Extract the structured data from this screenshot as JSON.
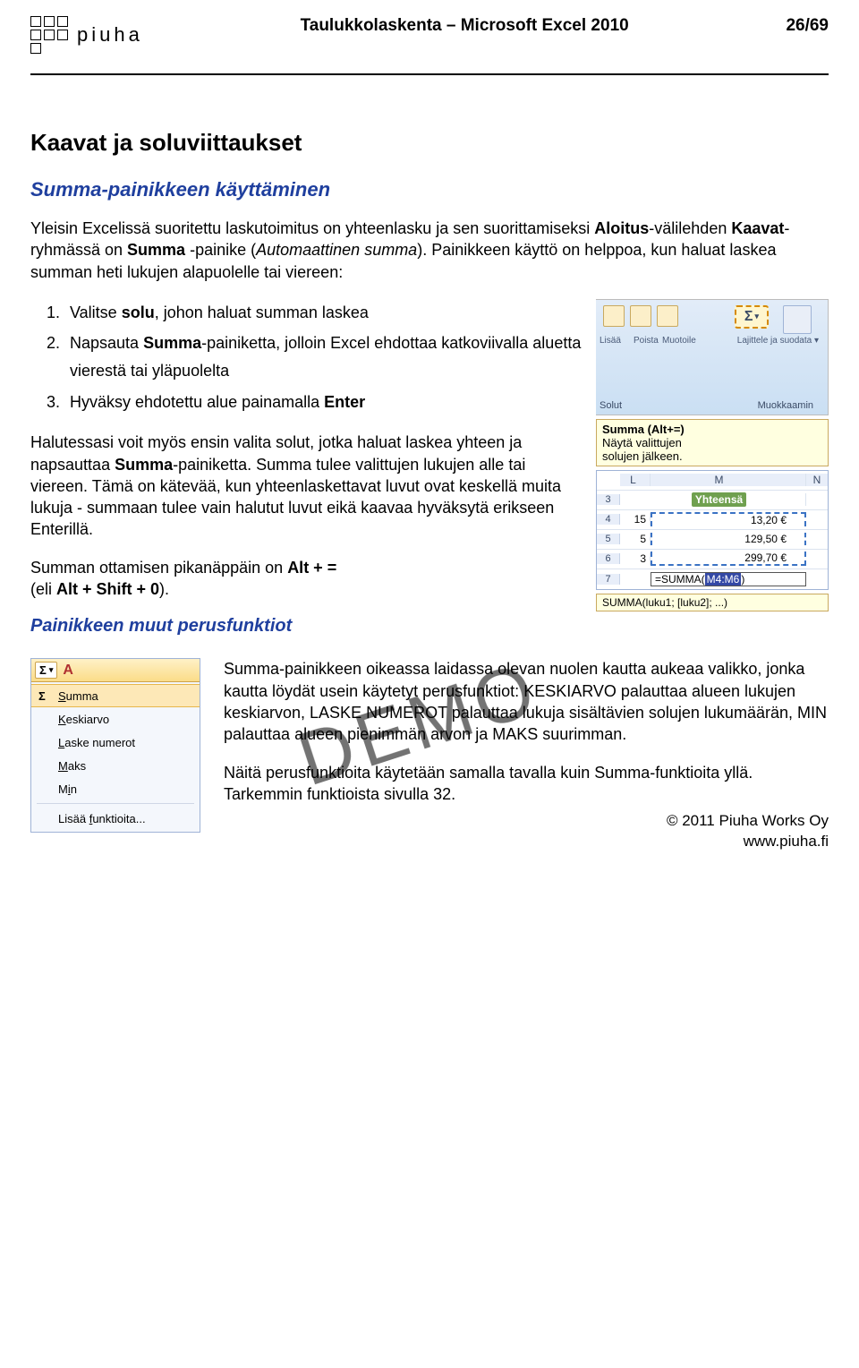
{
  "header": {
    "logo_text": "piuha",
    "doc_title": "Taulukkolaskenta – Microsoft Excel 2010",
    "page_number": "26/69"
  },
  "h1": "Kaavat ja soluviittaukset",
  "h2": "Summa-painikkeen käyttäminen",
  "intro_before_b1": "Yleisin Excelissä suoritettu laskutoimitus on yhteenlasku ja sen suorittamiseksi ",
  "intro_b1": "Aloitus",
  "intro_mid1": "-välilehden ",
  "intro_b2": "Kaavat",
  "intro_mid2": "-ryhmässä on ",
  "intro_b3": "Summa",
  "intro_mid3": " -painike (",
  "intro_i1": "Automaattinen summa",
  "intro_after": "). Painikkeen käyttö on helppoa, kun haluat laskea summan heti lukujen alapuolelle tai viereen:",
  "steps": {
    "s1_pre": "Valitse ",
    "s1_b": "solu",
    "s1_post": ", johon haluat summan laskea",
    "s2_pre": "Napsauta ",
    "s2_b": "Summa",
    "s2_post": "-painiketta, jolloin Excel ehdottaa katkoviivalla aluetta vierestä tai yläpuolelta",
    "s3_pre": "Hyväksy ehdotettu alue painamalla ",
    "s3_b": "Enter"
  },
  "para2_pre": "Halutessasi voit myös ensin valita solut, jotka haluat laskea yhteen ja napsauttaa ",
  "para2_b": "Summa",
  "para2_post": "-painiketta. Summa tulee valittujen lukujen alle tai viereen. Tämä on kätevää, kun yhteenlaskettavat luvut ovat keskellä muita lukuja - summaan tulee vain halutut luvut eikä kaavaa hyväksytä erikseen Enterillä.",
  "para3_pre": "Summan ottamisen pikanäppäin on ",
  "para3_b1": "Alt + =",
  "para3_mid": " (eli ",
  "para3_b2": "Alt + Shift + 0",
  "para3_post": ").",
  "h3": "Painikkeen muut perusfunktiot",
  "ribbon": {
    "lisaa": "Lisää",
    "poista": "Poista",
    "muotoile": "Muotoile",
    "lajittele": "Lajittele ja suodata ▾",
    "solut": "Solut",
    "muokkaamin": "Muokkaamin",
    "sigma": "Σ"
  },
  "tooltip": {
    "title": "Summa (Alt+=)",
    "line1": "Näytä valittujen",
    "line2": "solujen jälkeen."
  },
  "sheet": {
    "colL": "L",
    "colM": "M",
    "colN": "N",
    "r3": "3",
    "yhteensa": "Yhteensä",
    "r4": "4",
    "l4": "15",
    "m4": "13,20 €",
    "r5": "5",
    "l5": "5",
    "m5": "129,50 €",
    "r6": "6",
    "l6": "3",
    "m6": "299,70 €",
    "r7": "7",
    "formula_pre": "=SUMMA(",
    "formula_sel": "M4:M6",
    "formula_post": ")",
    "hint": "SUMMA(luku1; [luku2]; ...)"
  },
  "lower_para1": "Summa-painikkeen oikeassa laidassa olevan nuolen kautta aukeaa valikko, jonka kautta löydät usein käytetyt perusfunktiot: KESKIARVO palauttaa alueen lukujen keskiarvon, LASKE NUMEROT palauttaa lukuja sisältävien solujen lukumäärän, MIN palauttaa alueen pienimmän arvon ja MAKS suurimman.",
  "lower_para2": "Näitä perusfunktioita käytetään samalla tavalla kuin Summa-funktioita yllä. Tarkemmin funktioista sivulla 32.",
  "menu": {
    "sigma": "Σ",
    "summa": "Summa",
    "keskiarvo": "Keskiarvo",
    "laske": "Laske numerot",
    "maks": "Maks",
    "min": "Min",
    "lisaa": "Lisää funktioita..."
  },
  "watermark": "DEMO",
  "footer": {
    "line1": "© 2011 Piuha Works Oy",
    "line2": "www.piuha.fi"
  }
}
